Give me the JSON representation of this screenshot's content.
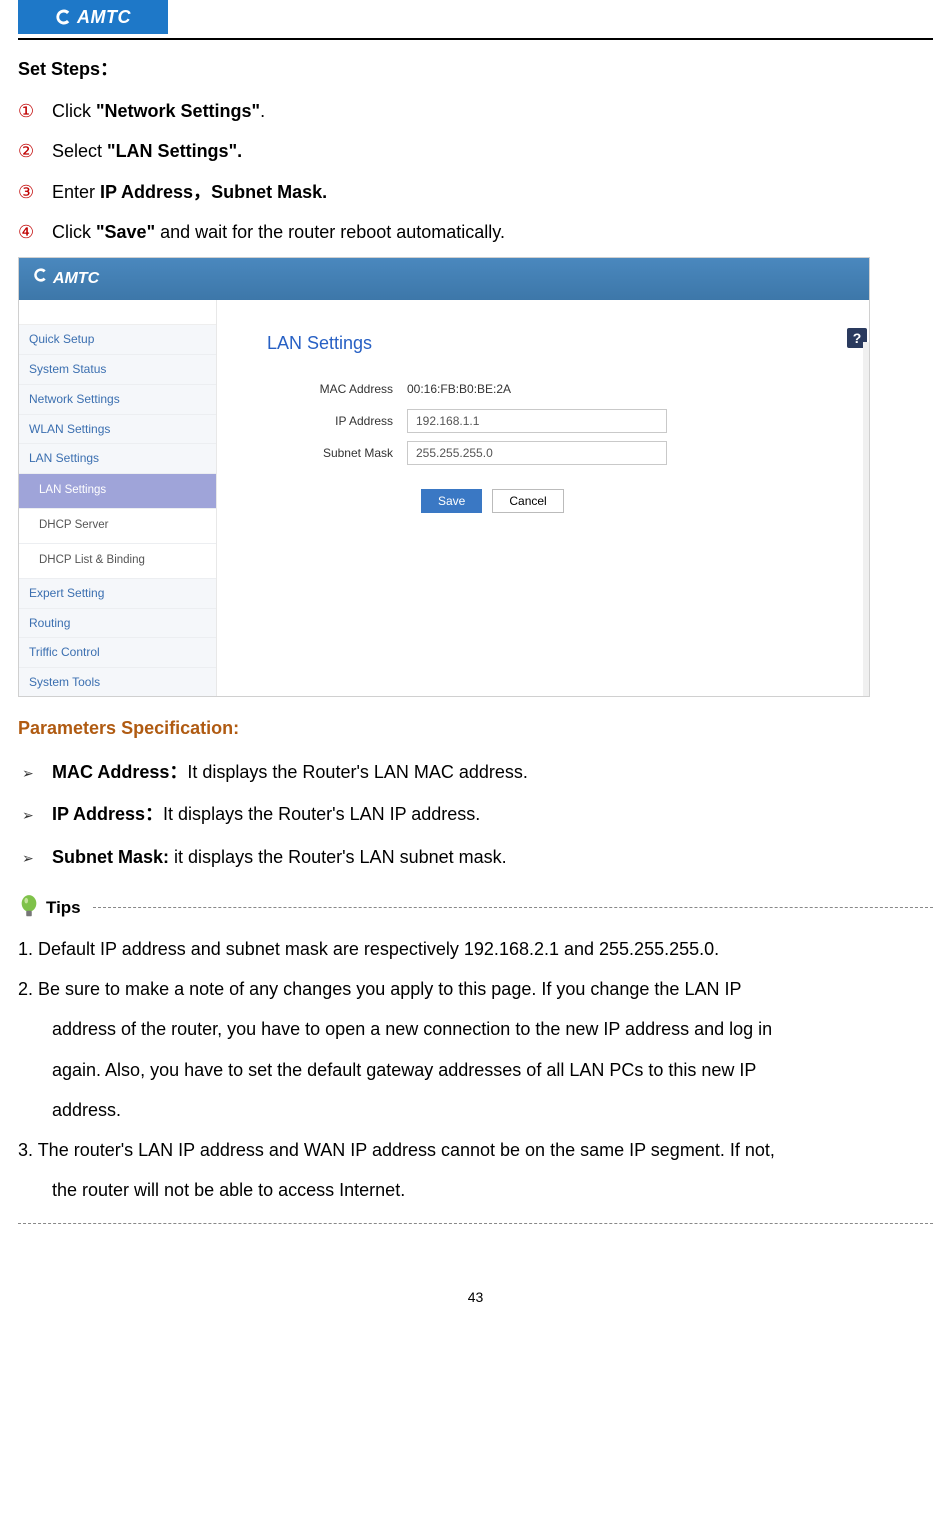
{
  "brand": "AMTC",
  "set_steps_heading": "Set Steps：",
  "steps": [
    {
      "num": "①",
      "pre": "Click ",
      "bold": "\"Network Settings\"",
      "post": "."
    },
    {
      "num": "②",
      "pre": "Select ",
      "bold": "\"LAN Settings\".",
      "post": ""
    },
    {
      "num": "③",
      "pre": "Enter ",
      "bold": "IP Address，Subnet Mask.",
      "post": ""
    },
    {
      "num": "④",
      "pre": "Click ",
      "bold": "\"Save\"",
      "post": " and wait for the router reboot automatically."
    }
  ],
  "router_ui": {
    "sidebar": {
      "items": [
        {
          "label": "Quick Setup",
          "type": "item"
        },
        {
          "label": "System Status",
          "type": "item"
        },
        {
          "label": "Network Settings",
          "type": "item"
        },
        {
          "label": "WLAN Settings",
          "type": "item"
        },
        {
          "label": "LAN Settings",
          "type": "item"
        },
        {
          "label": "LAN Settings",
          "type": "sub",
          "active": true
        },
        {
          "label": "DHCP Server",
          "type": "sub"
        },
        {
          "label": "DHCP List & Binding",
          "type": "sub"
        },
        {
          "label": "Expert Setting",
          "type": "item"
        },
        {
          "label": "Routing",
          "type": "item"
        },
        {
          "label": "Triffic Control",
          "type": "item"
        },
        {
          "label": "System Tools",
          "type": "item"
        }
      ]
    },
    "content": {
      "title": "LAN Settings",
      "mac_label": "MAC Address",
      "mac_value": "00:16:FB:B0:BE:2A",
      "ip_label": "IP Address",
      "ip_value": "192.168.1.1",
      "mask_label": "Subnet Mask",
      "mask_value": "255.255.255.0",
      "save_label": "Save",
      "cancel_label": "Cancel",
      "help_label": "?"
    }
  },
  "param_heading": "Parameters Specification:",
  "params": [
    {
      "bold": "MAC Address：",
      "text": "It displays the Router's LAN MAC address."
    },
    {
      "bold": "IP Address：",
      "text": "It displays the Router's LAN IP address."
    },
    {
      "bold": "Subnet Mask: ",
      "text": "it displays the Router's LAN subnet mask."
    }
  ],
  "tips_label": "Tips",
  "tips": {
    "t1": "1. Default IP address and subnet mask are respectively 192.168.2.1 and 255.255.255.0.",
    "t2a": "2. Be sure to make a note of any changes you apply to this page. If you change the LAN IP",
    "t2b": "address of the router, you have to open a new connection to the new IP address and log in",
    "t2c": "again. Also, you have to set the default gateway addresses of all LAN PCs to this new IP",
    "t2d": "address.",
    "t3a": "3. The router's LAN IP address and WAN IP address cannot be on the same IP segment. If not,",
    "t3b": "the router will not be able to access Internet."
  },
  "page_number": "43"
}
